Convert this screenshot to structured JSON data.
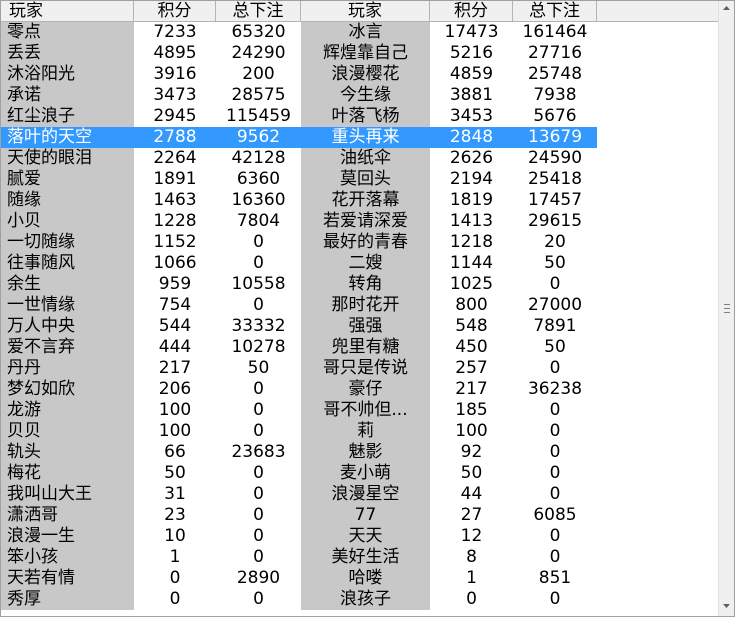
{
  "headers": [
    "玩家",
    "积分",
    "总下注",
    "玩家",
    "积分",
    "总下注"
  ],
  "selected_row": 5,
  "rows": [
    [
      "零点",
      "7233",
      "65320",
      "冰言",
      "17473",
      "161464"
    ],
    [
      "丢丢",
      "4895",
      "24290",
      "辉煌靠自己",
      "5216",
      "27716"
    ],
    [
      "沐浴阳光",
      "3916",
      "200",
      "浪漫樱花",
      "4859",
      "25748"
    ],
    [
      "承诺",
      "3473",
      "28575",
      "今生缘",
      "3881",
      "7938"
    ],
    [
      "红尘浪子",
      "2945",
      "115459",
      "叶落飞杨",
      "3453",
      "5676"
    ],
    [
      "落叶的天空",
      "2788",
      "9562",
      "重头再来",
      "2848",
      "13679"
    ],
    [
      "天使的眼泪",
      "2264",
      "42128",
      "油纸伞",
      "2626",
      "24590"
    ],
    [
      "腻爱",
      "1891",
      "6360",
      "莫回头",
      "2194",
      "25418"
    ],
    [
      "随缘",
      "1463",
      "16360",
      "花开落幕",
      "1819",
      "17457"
    ],
    [
      "小贝",
      "1228",
      "7804",
      "若爱请深爱",
      "1413",
      "29615"
    ],
    [
      "一切随缘",
      "1152",
      "0",
      "最好的青春",
      "1218",
      "20"
    ],
    [
      "往事随风",
      "1066",
      "0",
      "二嫂",
      "1144",
      "50"
    ],
    [
      "余生",
      "959",
      "10558",
      "转角",
      "1025",
      "0"
    ],
    [
      "一世情缘",
      "754",
      "0",
      "那时花开",
      "800",
      "27000"
    ],
    [
      "万人中央",
      "544",
      "33332",
      "强强",
      "548",
      "7891"
    ],
    [
      "爱不言弃",
      "444",
      "10278",
      "兜里有糖",
      "450",
      "50"
    ],
    [
      "丹丹",
      "217",
      "50",
      "哥只是传说",
      "257",
      "0"
    ],
    [
      "梦幻如欣",
      "206",
      "0",
      "豪仔",
      "217",
      "36238"
    ],
    [
      "龙游",
      "100",
      "0",
      "哥不帅但...",
      "185",
      "0"
    ],
    [
      "贝贝",
      "100",
      "0",
      "莉",
      "100",
      "0"
    ],
    [
      "轨头",
      "66",
      "23683",
      "魅影",
      "92",
      "0"
    ],
    [
      "梅花",
      "50",
      "0",
      "麦小萌",
      "50",
      "0"
    ],
    [
      "我叫山大王",
      "31",
      "0",
      "浪漫星空",
      "44",
      "0"
    ],
    [
      "潇洒哥",
      "23",
      "0",
      "77",
      "27",
      "6085"
    ],
    [
      "浪漫一生",
      "10",
      "0",
      "天天",
      "12",
      "0"
    ],
    [
      "笨小孩",
      "1",
      "0",
      "美好生活",
      "8",
      "0"
    ],
    [
      "天若有情",
      "0",
      "2890",
      "哈喽",
      "1",
      "851"
    ],
    [
      "秀厚",
      "0",
      "0",
      "浪孩子",
      "0",
      "0"
    ]
  ]
}
